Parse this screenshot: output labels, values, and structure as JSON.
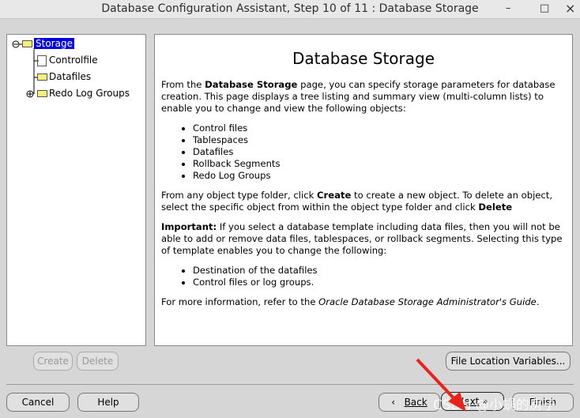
{
  "window": {
    "title": "Database Configuration Assistant, Step 10 of 11 : Database Storage",
    "minimize": "–",
    "maximize": "□",
    "close": "×"
  },
  "tree": {
    "root": "Storage",
    "children": [
      "Controlfile",
      "Datafiles",
      "Redo Log Groups"
    ]
  },
  "content": {
    "heading": "Database Storage",
    "p1_a": "From the ",
    "p1_b": "Database Storage",
    "p1_c": " page, you can specify storage parameters for database creation. This page displays a tree listing and summary view (multi-column lists) to enable you to change and view the following objects:",
    "list1": [
      "Control files",
      "Tablespaces",
      "Datafiles",
      "Rollback Segments",
      "Redo Log Groups"
    ],
    "p2_a": "From any object type folder, click ",
    "p2_b": "Create",
    "p2_c": " to create a new object. To delete an object, select the specific object from within the object type folder and click ",
    "p2_d": "Delete",
    "p3_a": "Important:",
    "p3_b": " If you select a database template including data files, then you will not be able to add or remove data files, tablespaces, or rollback segments. Selecting this type of template enables you to change the following:",
    "list2": [
      "Destination of the datafiles",
      "Control files or log groups."
    ],
    "p4_a": "For more information, refer to the ",
    "p4_b": "Oracle Database Storage Administrator's Guide",
    "p4_c": "."
  },
  "buttons": {
    "create": "Create",
    "delete": "Delete",
    "file_location": "File Location Variables...",
    "cancel": "Cancel",
    "help": "Help",
    "back": "Back",
    "next": "Next",
    "finish": "Finish"
  },
  "watermark": "CSDN @小蜗的房子",
  "annotation_color": "#e8231c"
}
